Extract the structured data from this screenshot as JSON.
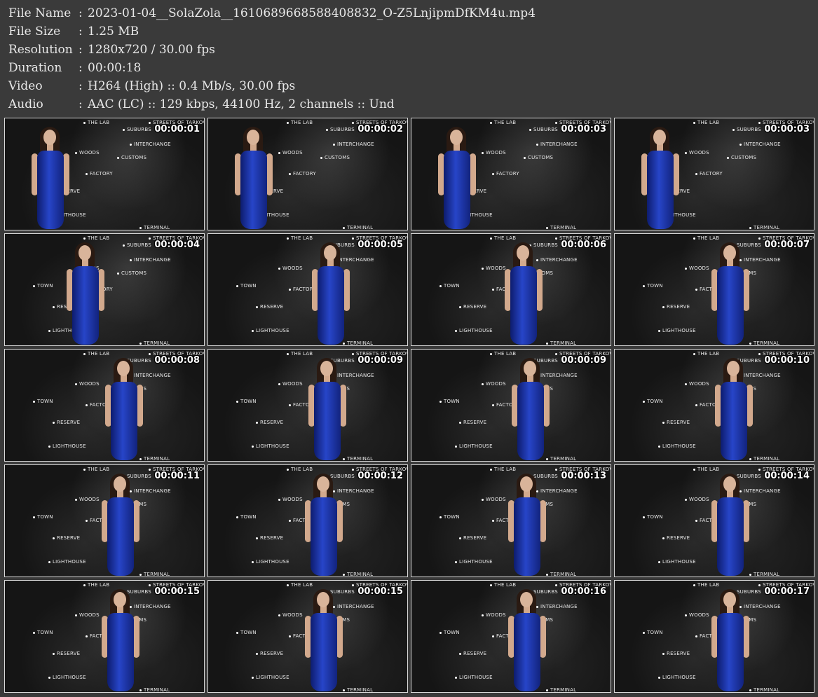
{
  "file_info": [
    {
      "key": "File Name",
      "value": "2023-01-04__SolaZola__1610689668588408832_O-Z5LnjipmDfKM4u.mp4"
    },
    {
      "key": "File Size",
      "value": "1.25 MB"
    },
    {
      "key": "Resolution",
      "value": "1280x720 / 30.00 fps"
    },
    {
      "key": "Duration",
      "value": "00:00:18"
    },
    {
      "key": "Video",
      "value": "H264 (High) :: 0.4 Mb/s, 30.00 fps"
    },
    {
      "key": "Audio",
      "value": "AAC (LC) :: 129 kbps, 44100 Hz, 2 channels :: Und"
    }
  ],
  "separator": ":",
  "map_labels": [
    "THE LAB",
    "STREETS OF TARKOV",
    "SUBURBS",
    "INTERCHANGE",
    "WOODS",
    "CUSTOMS",
    "TOWN",
    "FACTORY",
    "RESERVE",
    "LIGHTHOUSE",
    "TERMINAL"
  ],
  "thumbnails": [
    {
      "time": "00:00:01"
    },
    {
      "time": "00:00:02"
    },
    {
      "time": "00:00:03"
    },
    {
      "time": "00:00:03"
    },
    {
      "time": "00:00:04"
    },
    {
      "time": "00:00:05"
    },
    {
      "time": "00:00:06"
    },
    {
      "time": "00:00:07"
    },
    {
      "time": "00:00:08"
    },
    {
      "time": "00:00:09"
    },
    {
      "time": "00:00:09"
    },
    {
      "time": "00:00:10"
    },
    {
      "time": "00:00:11"
    },
    {
      "time": "00:00:12"
    },
    {
      "time": "00:00:13"
    },
    {
      "time": "00:00:14"
    },
    {
      "time": "00:00:15"
    },
    {
      "time": "00:00:15"
    },
    {
      "time": "00:00:16"
    },
    {
      "time": "00:00:17"
    }
  ]
}
